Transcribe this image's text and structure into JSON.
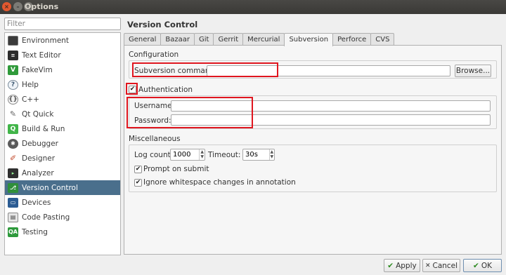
{
  "window": {
    "title": "Options"
  },
  "filter": {
    "placeholder": "Filter",
    "value": ""
  },
  "sidebar": {
    "items": [
      {
        "label": "Environment",
        "icon": "monitor-icon"
      },
      {
        "label": "Text Editor",
        "icon": "text-editor-icon"
      },
      {
        "label": "FakeVim",
        "icon": "vim-icon"
      },
      {
        "label": "Help",
        "icon": "help-icon"
      },
      {
        "label": "C++",
        "icon": "cpp-icon"
      },
      {
        "label": "Qt Quick",
        "icon": "qt-quick-icon"
      },
      {
        "label": "Build & Run",
        "icon": "build-run-icon"
      },
      {
        "label": "Debugger",
        "icon": "debugger-icon"
      },
      {
        "label": "Designer",
        "icon": "designer-icon"
      },
      {
        "label": "Analyzer",
        "icon": "analyzer-icon"
      },
      {
        "label": "Version Control",
        "icon": "version-control-icon"
      },
      {
        "label": "Devices",
        "icon": "devices-icon"
      },
      {
        "label": "Code Pasting",
        "icon": "code-pasting-icon"
      },
      {
        "label": "Testing",
        "icon": "testing-icon"
      }
    ],
    "selected": "Version Control"
  },
  "page": {
    "title": "Version Control"
  },
  "tabs": [
    "General",
    "Bazaar",
    "Git",
    "Gerrit",
    "Mercurial",
    "Subversion",
    "Perforce",
    "CVS"
  ],
  "active_tab": "Subversion",
  "configuration": {
    "title": "Configuration",
    "command_label": "Subversion command:",
    "command_value": "",
    "browse_label": "Browse..."
  },
  "authentication": {
    "label": "Authentication",
    "checked": true,
    "username_label": "Username:",
    "username_value": "",
    "password_label": "Password:",
    "password_value": ""
  },
  "miscellaneous": {
    "title": "Miscellaneous",
    "log_count_label": "Log count:",
    "log_count_value": "1000",
    "timeout_label": "Timeout:",
    "timeout_value": "30s",
    "prompt_label": "Prompt on submit",
    "prompt_checked": true,
    "ignore_ws_label": "Ignore whitespace changes in annotation",
    "ignore_ws_checked": true
  },
  "footer": {
    "apply_label": "Apply",
    "cancel_label": "Cancel",
    "ok_label": "OK"
  },
  "colors": {
    "selection": "#4a6f8c",
    "highlight": "#e0161f",
    "titlebar": "#3a3936"
  }
}
